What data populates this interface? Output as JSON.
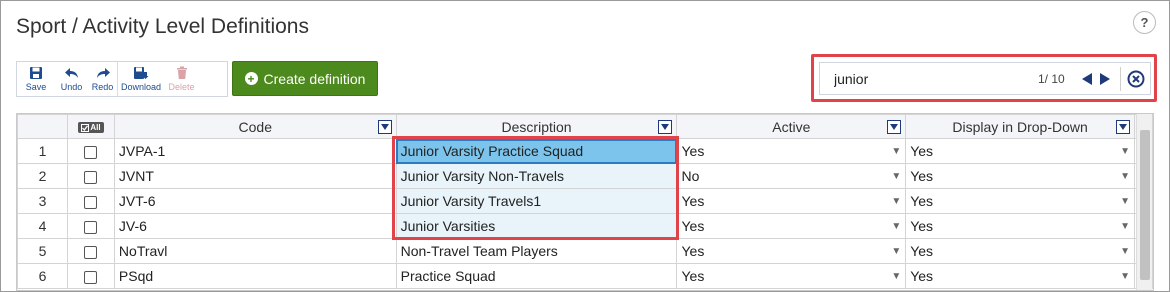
{
  "page": {
    "title": "Sport / Activity Level Definitions",
    "help_label": "?"
  },
  "toolbar": {
    "save_label": "Save",
    "undo_label": "Undo",
    "redo_label": "Redo",
    "download_label": "Download",
    "delete_label": "Delete",
    "create_label": "Create definition",
    "create_icon": "plus-circle-icon"
  },
  "search": {
    "value": "junior",
    "count": "1/ 10"
  },
  "grid": {
    "all_label": "All",
    "columns": [
      "Code",
      "Description",
      "Active",
      "Display in Drop-Down"
    ],
    "rows": [
      {
        "num": "1",
        "code": "JVPA-1",
        "description": "Junior Varsity Practice Squad",
        "active": "Yes",
        "display": "Yes"
      },
      {
        "num": "2",
        "code": "JVNT",
        "description": "Junior Varsity Non-Travels",
        "active": "No",
        "display": "Yes"
      },
      {
        "num": "3",
        "code": "JVT-6",
        "description": "Junior Varsity Travels1",
        "active": "Yes",
        "display": "Yes"
      },
      {
        "num": "4",
        "code": "JV-6",
        "description": "Junior Varsities",
        "active": "Yes",
        "display": "Yes"
      },
      {
        "num": "5",
        "code": "NoTravl",
        "description": "Non-Travel Team Players",
        "active": "Yes",
        "display": "Yes"
      },
      {
        "num": "6",
        "code": "PSqd",
        "description": "Practice Squad",
        "active": "Yes",
        "display": "Yes"
      }
    ]
  },
  "colors": {
    "accent": "#1e3a7a",
    "create_bg": "#4d8a1d",
    "highlight": "#e0434a",
    "match_bg": "#e8f4fa",
    "active_cell": "#7cc4ec"
  }
}
